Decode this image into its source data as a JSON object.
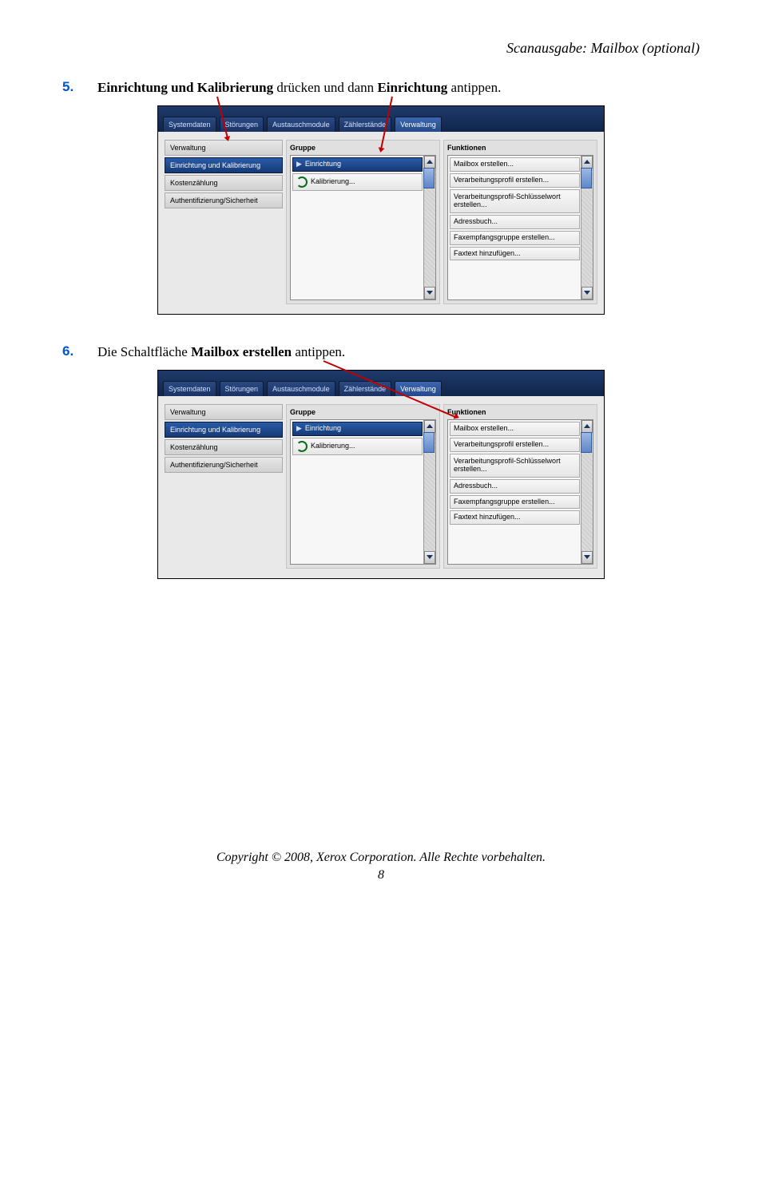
{
  "header": {
    "title": "Scanausgabe: Mailbox (optional)"
  },
  "step5": {
    "num": "5.",
    "html_parts": {
      "b1": "Einrichtung und Kalibrierung",
      "t1": " drücken und dann ",
      "b2": "Einrichtung",
      "t2": " antippen."
    }
  },
  "step6": {
    "num": "6.",
    "html_parts": {
      "t0": "Die Schaltfläche ",
      "b1": "Mailbox erstellen",
      "t1": " antippen."
    }
  },
  "tabs": {
    "systemdaten": "Systemdaten",
    "stoerungen": "Störungen",
    "austauschmodule": "Austauschmodule",
    "zaehlerstaende": "Zählerstände",
    "verwaltung": "Verwaltung"
  },
  "sidebar": {
    "verwaltung": "Verwaltung",
    "einrichtung": "Einrichtung und Kalibrierung",
    "kostenzaehlung": "Kostenzählung",
    "auth": "Authentifizierung/Sicherheit"
  },
  "cols": {
    "gruppe": "Gruppe",
    "funktionen": "Funktionen"
  },
  "gruppe_items": {
    "einrichtung": "Einrichtung",
    "kalibrierung": "Kalibrierung..."
  },
  "funktionen_items": {
    "mailbox": "Mailbox erstellen...",
    "verarbeitungsprofil": "Verarbeitungsprofil erstellen...",
    "schluesselwort": "Verarbeitungsprofil-Schlüsselwort erstellen...",
    "adressbuch": "Adressbuch...",
    "faxgruppe": "Faxempfangsgruppe erstellen...",
    "faxtext": "Faxtext hinzufügen..."
  },
  "footer": {
    "copyright": "Copyright © 2008, Xerox Corporation. Alle Rechte vorbehalten.",
    "page": "8"
  }
}
